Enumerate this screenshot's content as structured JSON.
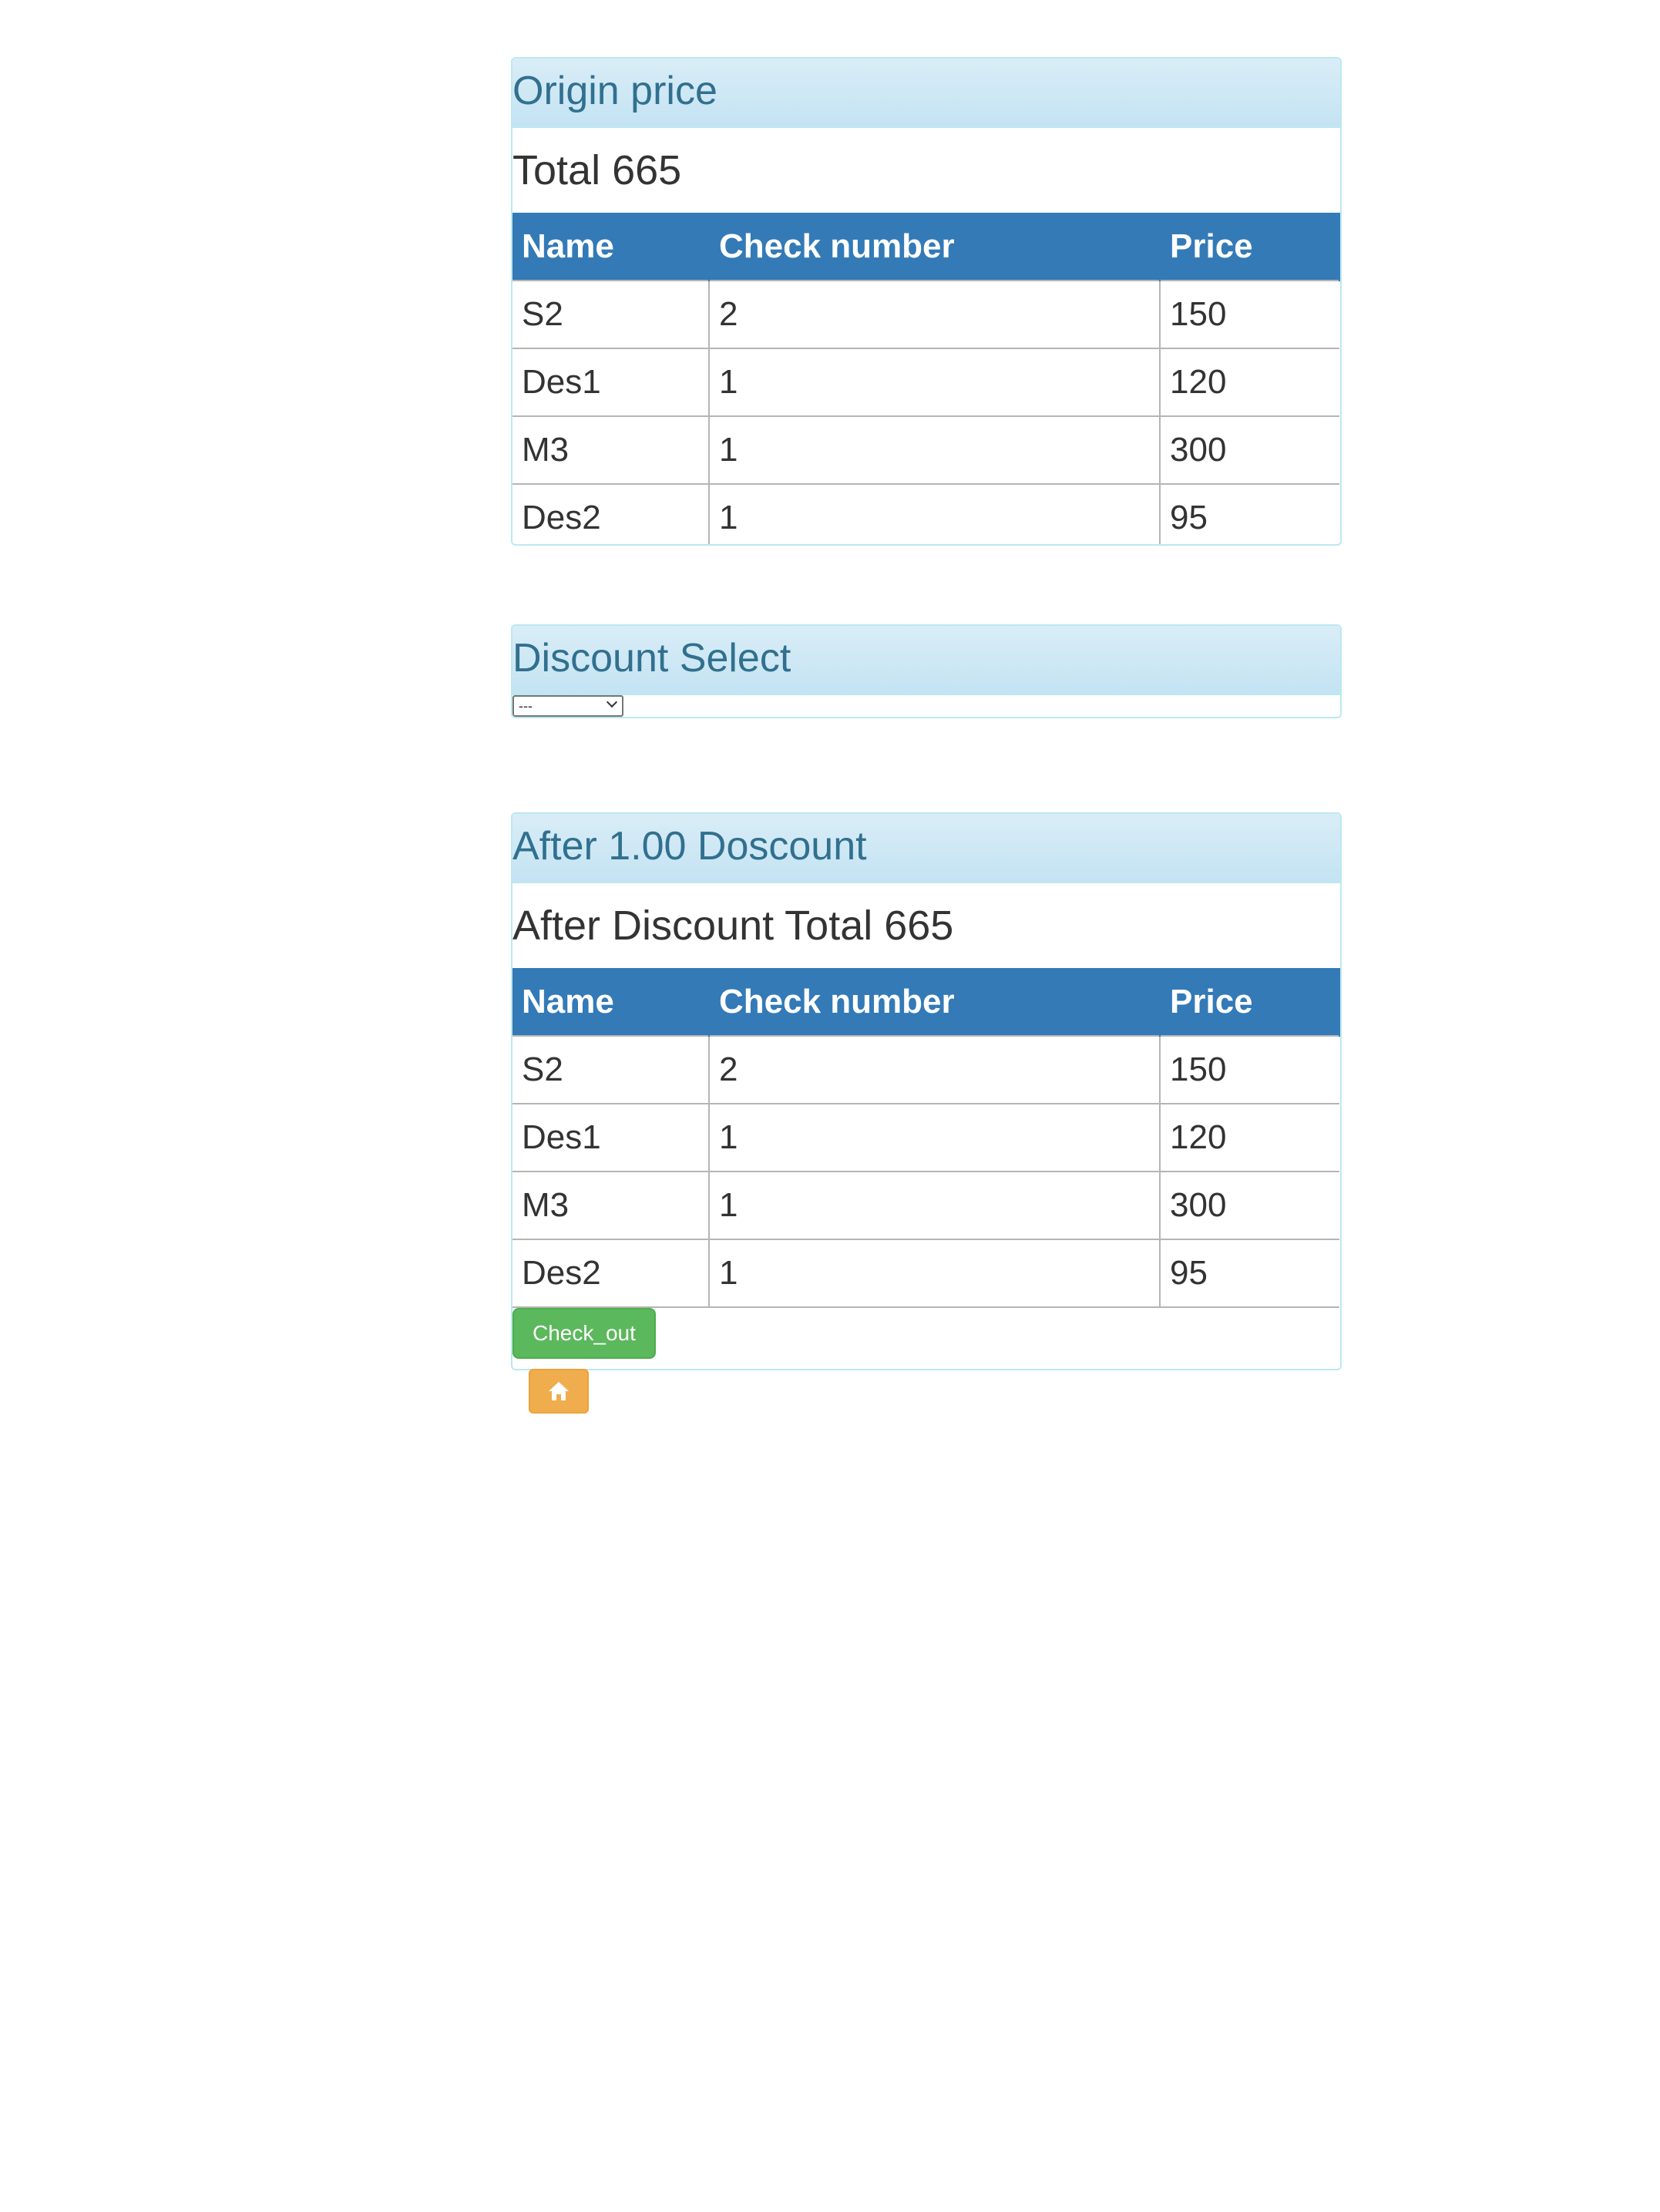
{
  "origin_panel": {
    "title": "Origin price",
    "total_line": "Total 665",
    "columns": [
      "Name",
      "Check number",
      "Price"
    ],
    "rows": [
      {
        "name": "S2",
        "check_number": "2",
        "price": "150"
      },
      {
        "name": "Des1",
        "check_number": "1",
        "price": "120"
      },
      {
        "name": "M3",
        "check_number": "1",
        "price": "300"
      },
      {
        "name": "Des2",
        "check_number": "1",
        "price": "95"
      }
    ]
  },
  "discount_panel": {
    "title": "Discount Select",
    "select_value": "---"
  },
  "after_panel": {
    "title": "After 1.00 Doscount",
    "total_line": "After Discount Total 665",
    "columns": [
      "Name",
      "Check number",
      "Price"
    ],
    "rows": [
      {
        "name": "S2",
        "check_number": "2",
        "price": "150"
      },
      {
        "name": "Des1",
        "check_number": "1",
        "price": "120"
      },
      {
        "name": "M3",
        "check_number": "1",
        "price": "300"
      },
      {
        "name": "Des2",
        "check_number": "1",
        "price": "95"
      }
    ],
    "checkout_label": "Check_out"
  },
  "home_button": {
    "icon": "home-icon"
  },
  "colors": {
    "panel_heading_bg": "#d9edf7",
    "panel_title": "#31708f",
    "table_header_bg": "#337ab7",
    "checkout_bg": "#5cb85c",
    "home_bg": "#f0ad4e"
  }
}
